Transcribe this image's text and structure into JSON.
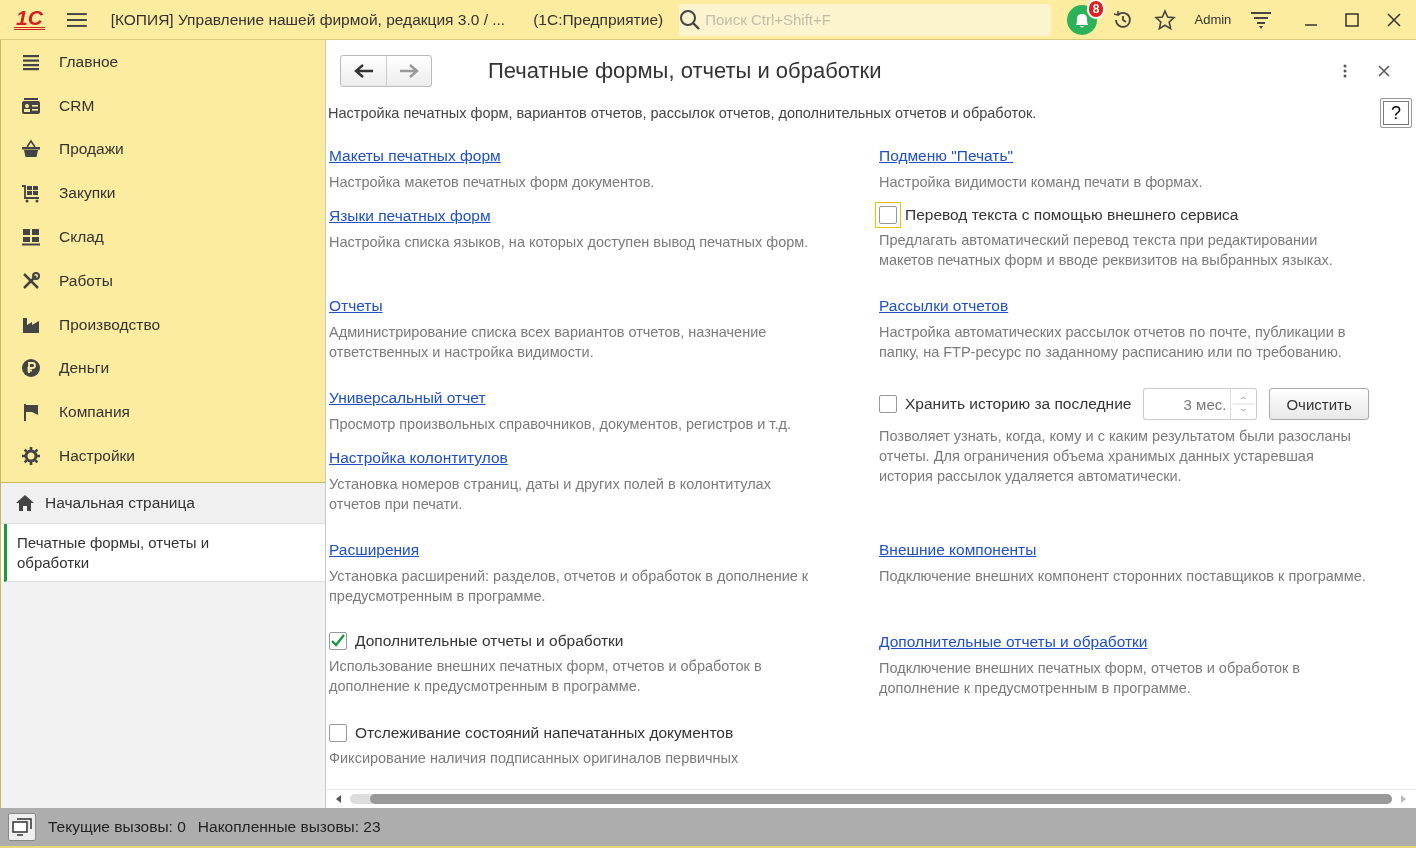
{
  "window": {
    "logo": "1С",
    "title": "[КОПИЯ] Управление нашей фирмой, редакция 3.0 / ...",
    "app": "(1С:Предприятие)",
    "user": "Admin"
  },
  "search": {
    "placeholder": "Поиск Ctrl+Shift+F"
  },
  "notifications": {
    "count": "8"
  },
  "sidebar": {
    "items": [
      {
        "label": "Главное"
      },
      {
        "label": "CRM"
      },
      {
        "label": "Продажи"
      },
      {
        "label": "Закупки"
      },
      {
        "label": "Склад"
      },
      {
        "label": "Работы"
      },
      {
        "label": "Производство"
      },
      {
        "label": "Деньги"
      },
      {
        "label": "Компания"
      },
      {
        "label": "Настройки"
      }
    ],
    "home": {
      "label": "Начальная страница"
    },
    "open_windows": [
      {
        "label": "Печатные формы, отчеты и обработки",
        "selected": true
      }
    ]
  },
  "form": {
    "title": "Печатные формы, отчеты и обработки",
    "subtitle": "Настройка печатных форм, вариантов отчетов, рассылок отчетов, дополнительных отчетов и обработок.",
    "help": "?",
    "rows": [
      {
        "left": [
          {
            "kind": "link",
            "label": "Макеты печатных форм",
            "description": "Настройка макетов печатных форм документов."
          },
          {
            "kind": "link",
            "label": "Языки печатных форм",
            "description": "Настройка списка языков, на которых доступен вывод печатных форм."
          }
        ],
        "right": [
          {
            "kind": "link",
            "label": "Подменю \"Печать\"",
            "description": "Настройка видимости команд печати в формах."
          },
          {
            "kind": "checkbox",
            "label": "Перевод текста с помощью внешнего сервиса",
            "checked": false,
            "focused": true,
            "description": "Предлагать автоматический перевод текста при редактировании макетов печатных форм и вводе реквизитов на выбранных языках."
          }
        ]
      },
      {
        "left": [
          {
            "kind": "link",
            "label": "Отчеты",
            "description": "Администрирование списка всех вариантов отчетов, назначение ответственных и настройка видимости."
          }
        ],
        "right": [
          {
            "kind": "link",
            "label": "Рассылки отчетов",
            "description": "Настройка автоматических рассылок отчетов по почте, публикации в папку, на FTP-ресурс по заданному расписанию или по требованию."
          }
        ]
      },
      {
        "left": [
          {
            "kind": "link",
            "label": "Универсальный отчет",
            "description": "Просмотр произвольных справочников, документов, регистров и т.д."
          },
          {
            "kind": "link",
            "label": "Настройка колонтитулов",
            "description": "Установка номеров страниц, даты и других полей в колонтитулах отчетов при печати."
          }
        ],
        "right": [
          {
            "kind": "history",
            "label": "Хранить историю за последние",
            "checked": false,
            "value": "3 мес.",
            "button": "Очистить",
            "description": "Позволяет узнать, когда, кому и с каким результатом были разосланы отчеты. Для ограничения объема хранимых данных устаревшая история рассылок удаляется автоматически."
          }
        ]
      },
      {
        "left": [
          {
            "kind": "link",
            "label": "Расширения",
            "description": "Установка расширений: разделов, отчетов и обработок в дополнение к предусмотренным в программе."
          }
        ],
        "right": [
          {
            "kind": "link",
            "label": "Внешние компоненты",
            "description": "Подключение внешних компонент сторонних поставщиков к программе."
          }
        ]
      },
      {
        "left": [
          {
            "kind": "checkbox",
            "label": "Дополнительные отчеты и обработки",
            "checked": true,
            "description": "Использование внешних печатных форм, отчетов и обработок в дополнение к предусмотренным в программе."
          }
        ],
        "right": [
          {
            "kind": "link",
            "label": "Дополнительные отчеты и обработки",
            "description": "Подключение внешних печатных форм, отчетов и обработок в дополнение к предусмотренным в программе."
          }
        ]
      },
      {
        "left": [
          {
            "kind": "checkbox",
            "label": "Отслеживание состояний напечатанных документов",
            "checked": false,
            "description": "Фиксирование наличия подписанных оригиналов первичных"
          }
        ],
        "right": []
      }
    ]
  },
  "status_bar": {
    "current": "Текущие вызовы: 0",
    "accumulated": "Накопленные вызовы: 23"
  }
}
